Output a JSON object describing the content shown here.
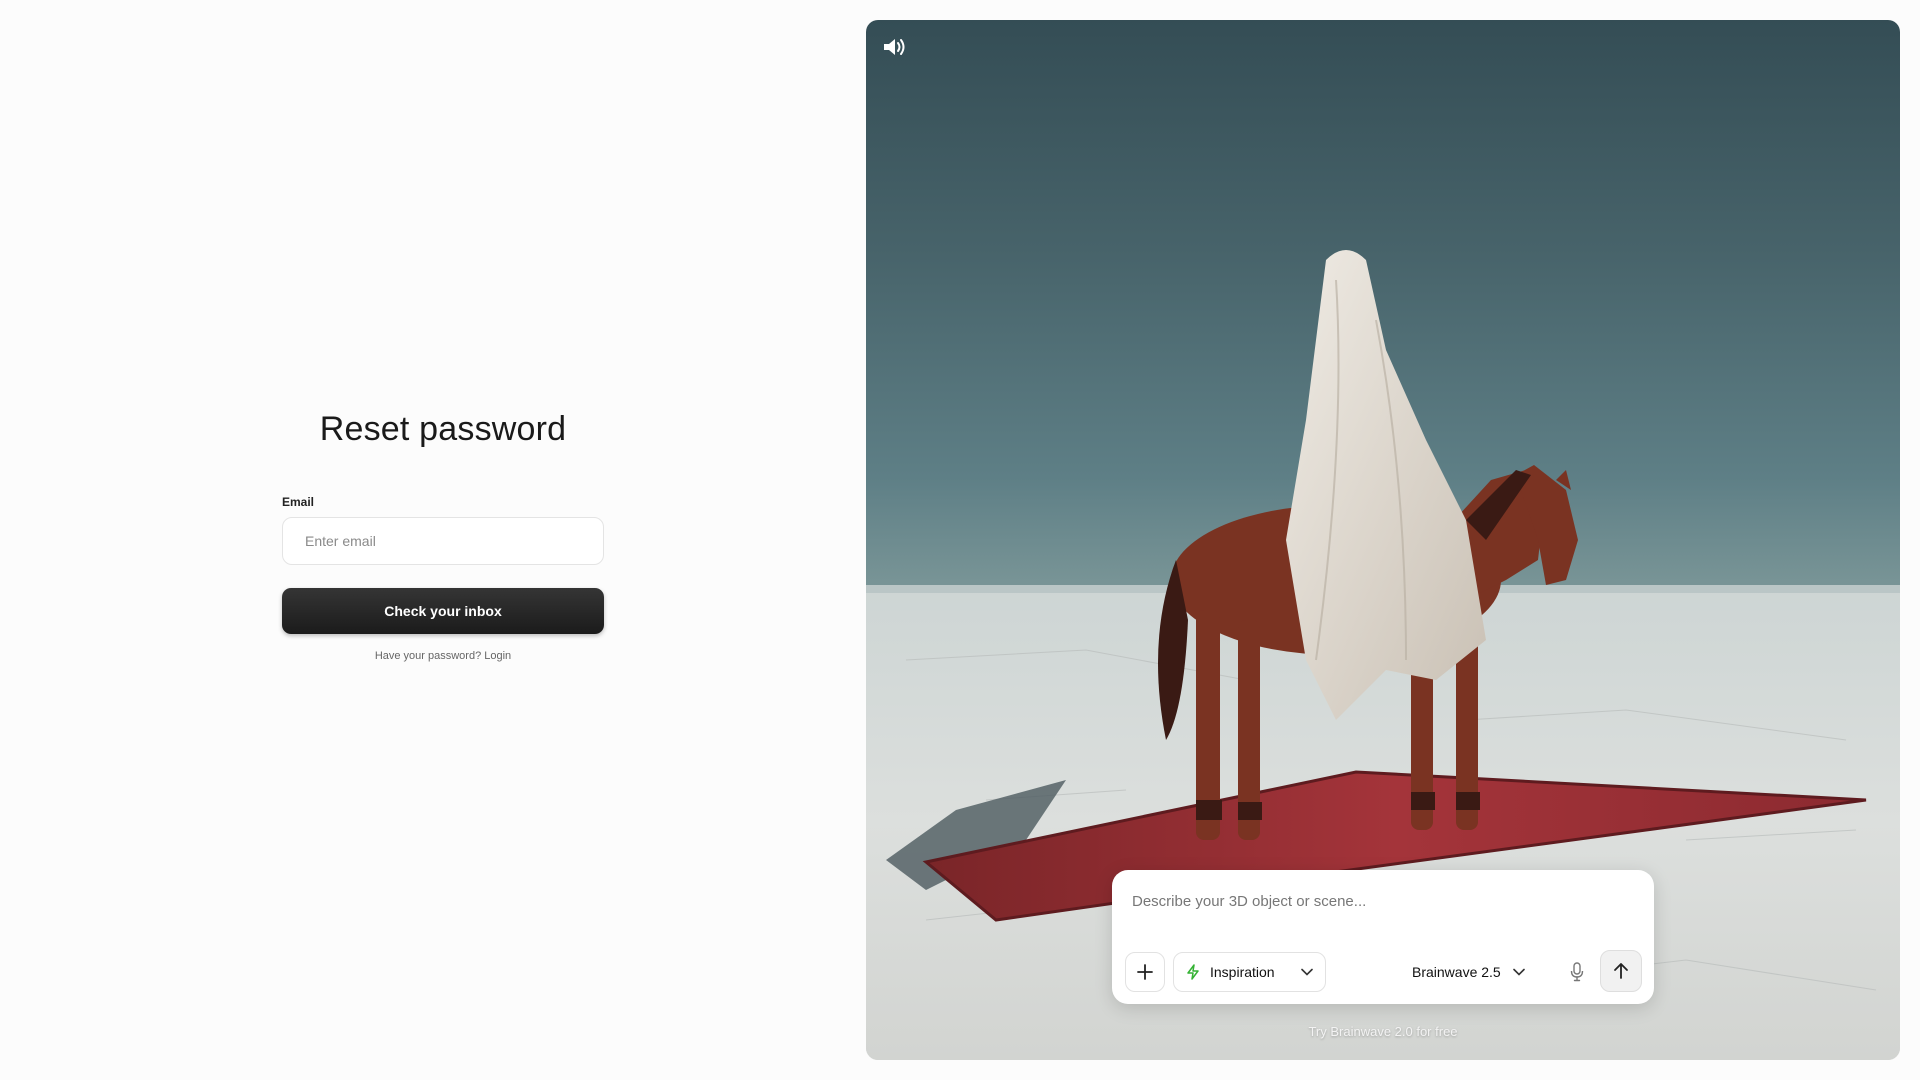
{
  "form": {
    "title": "Reset password",
    "email_label": "Email",
    "email_placeholder": "Enter email",
    "email_value": "",
    "submit_label": "Check your inbox",
    "login_prompt": "Have your password? Login"
  },
  "hero": {
    "sound_icon": "speaker-icon",
    "prompt_placeholder": "Describe your 3D object or scene...",
    "add_icon": "plus-icon",
    "inspiration_icon": "lightning-icon",
    "inspiration_label": "Inspiration",
    "model_label": "Brainwave 2.5",
    "mic_icon": "microphone-icon",
    "send_icon": "arrow-up-icon",
    "footer_link": "Try Brainwave 2.0 for free",
    "colors": {
      "accent_green": "#34b233",
      "button_dark": "#1f1f1f"
    }
  }
}
